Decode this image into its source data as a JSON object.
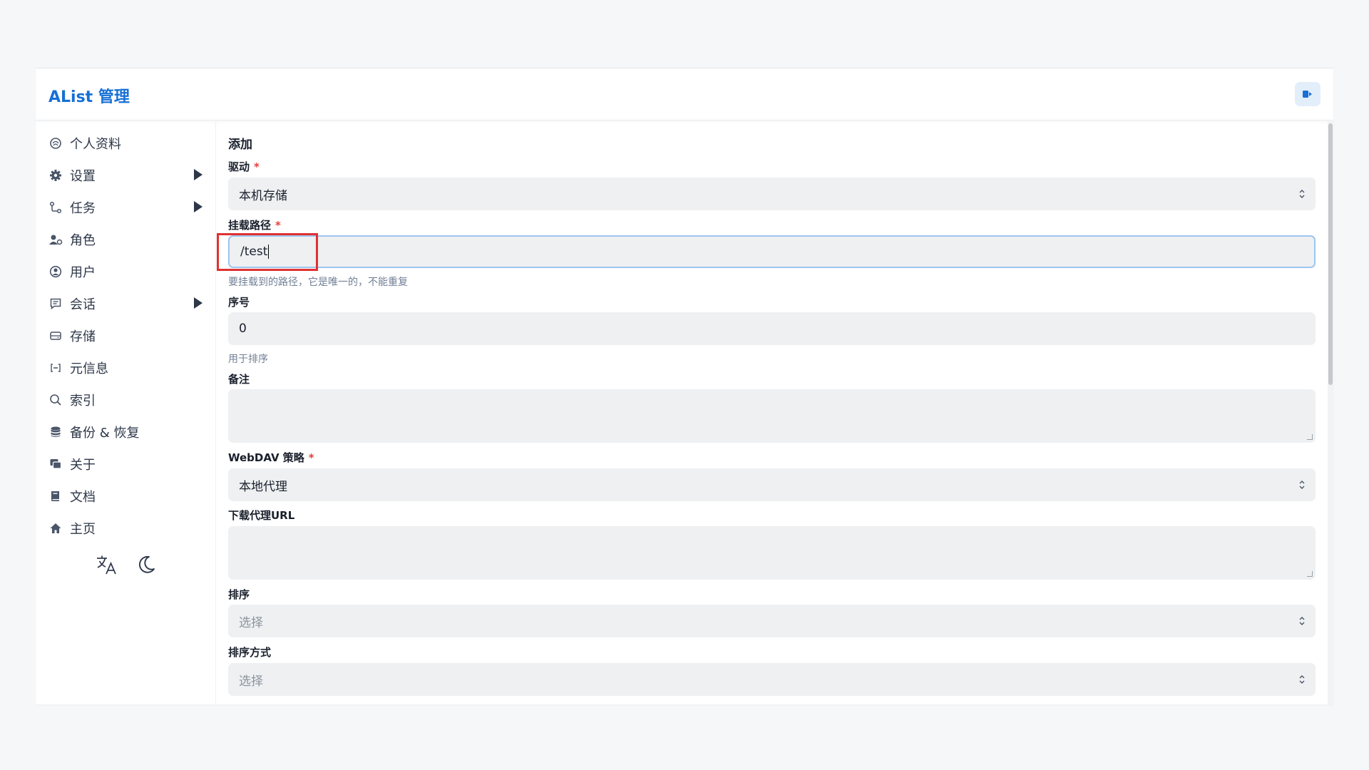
{
  "app": {
    "title": "AList 管理"
  },
  "sidebar": {
    "items": [
      {
        "label": "个人资料",
        "icon": "profile-icon",
        "expandable": false
      },
      {
        "label": "设置",
        "icon": "gear-icon",
        "expandable": true
      },
      {
        "label": "任务",
        "icon": "tasks-icon",
        "expandable": true
      },
      {
        "label": "角色",
        "icon": "role-icon",
        "expandable": false
      },
      {
        "label": "用户",
        "icon": "user-icon",
        "expandable": false
      },
      {
        "label": "会话",
        "icon": "session-icon",
        "expandable": true
      },
      {
        "label": "存储",
        "icon": "storage-icon",
        "expandable": false
      },
      {
        "label": "元信息",
        "icon": "meta-icon",
        "expandable": false
      },
      {
        "label": "索引",
        "icon": "search-icon",
        "expandable": false
      },
      {
        "label": "备份 & 恢复",
        "icon": "database-icon",
        "expandable": false
      },
      {
        "label": "关于",
        "icon": "about-icon",
        "expandable": false
      },
      {
        "label": "文档",
        "icon": "book-icon",
        "expandable": false
      },
      {
        "label": "主页",
        "icon": "home-icon",
        "expandable": false
      }
    ]
  },
  "form": {
    "title": "添加",
    "driver": {
      "label": "驱动",
      "required": "*",
      "value": "本机存储"
    },
    "mount_path": {
      "label": "挂载路径",
      "required": "*",
      "value": "/test",
      "hint": "要挂载到的路径，它是唯一的，不能重复"
    },
    "order": {
      "label": "序号",
      "value": "0",
      "hint": "用于排序"
    },
    "remark": {
      "label": "备注",
      "value": ""
    },
    "webdav": {
      "label": "WebDAV 策略",
      "required": "*",
      "value": "本地代理"
    },
    "proxy_url": {
      "label": "下载代理URL",
      "value": ""
    },
    "sort": {
      "label": "排序",
      "placeholder": "选择"
    },
    "sort_direction": {
      "label": "排序方式",
      "placeholder": "选择"
    }
  },
  "colors": {
    "accent": "#1670d6",
    "highlight": "#e03131",
    "required": "#e53e3e"
  }
}
